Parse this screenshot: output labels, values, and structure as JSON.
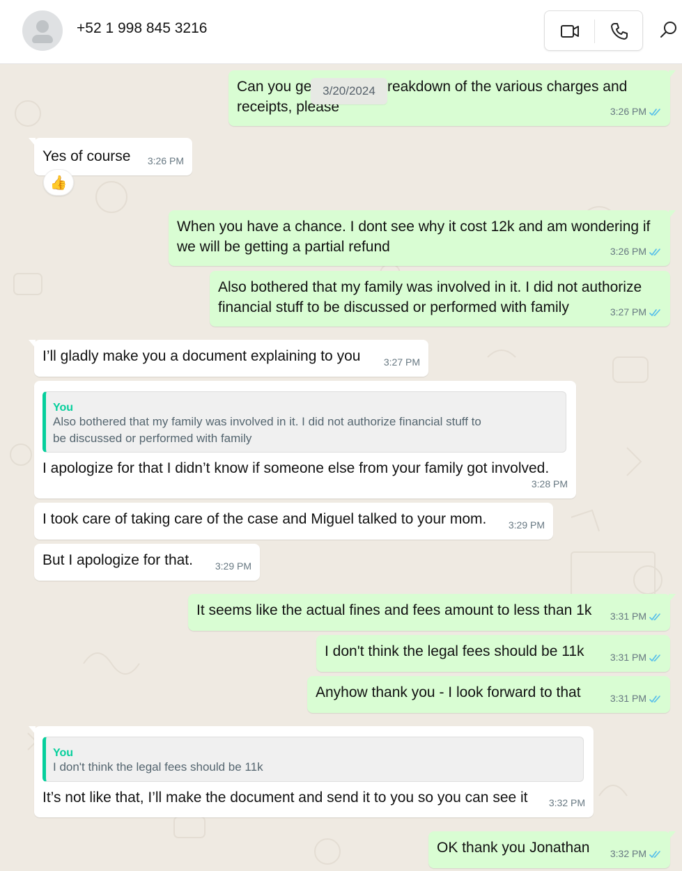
{
  "header": {
    "contact": "+52 1 998 845 3216",
    "video_icon": "video-camera-icon",
    "phone_icon": "phone-icon",
    "search_icon": "search-icon"
  },
  "chat": {
    "date_label": "3/20/2024",
    "messages": [
      {
        "from": "me",
        "line1": "Can you get a written breakdown of the various charges and",
        "line2": "receipts, please",
        "time": "3:26 PM"
      },
      {
        "from": "them",
        "text": "Yes of course",
        "time": "3:26 PM",
        "reaction": "👍"
      },
      {
        "from": "me",
        "line1": "When you have a chance.  I dont see why it cost 12k and am wondering if",
        "line2": "we will be getting a partial refund",
        "time": "3:26 PM"
      },
      {
        "from": "me",
        "line1": "Also bothered that my family was involved in it.  I did not authorize",
        "line2": "financial stuff to be discussed or performed with family",
        "time": "3:27 PM"
      },
      {
        "from": "them",
        "text": "I’ll gladly make you a document explaining to you",
        "time": "3:27 PM"
      },
      {
        "from": "them",
        "quote_name": "You",
        "quote_line1": "Also bothered that my family was involved in it.  I did not authorize financial stuff to",
        "quote_line2": "be discussed or performed with family",
        "text": "I apologize for that I didn’t know if someone else from your family got involved.",
        "time": "3:28 PM"
      },
      {
        "from": "them",
        "text": "I took care of taking care of the case and Miguel talked to your mom.",
        "time": "3:29 PM"
      },
      {
        "from": "them",
        "text": "But I apologize for that.",
        "time": "3:29 PM"
      },
      {
        "from": "me",
        "text": "It seems like the actual fines and fees amount to less than 1k",
        "time": "3:31 PM"
      },
      {
        "from": "me",
        "text": "I don't think the legal fees should be 11k",
        "time": "3:31 PM"
      },
      {
        "from": "me",
        "text": "Anyhow thank you - I look forward to that",
        "time": "3:31 PM"
      },
      {
        "from": "them",
        "quote_name": "You",
        "quote_line1": "I don't think the legal fees should be 11k",
        "text": "It’s not like that, I’ll make the document and send it to you so you can see it",
        "time": "3:32 PM"
      },
      {
        "from": "me",
        "text": "OK thank you Jonathan",
        "time": "3:32 PM"
      }
    ]
  },
  "colors": {
    "outgoing_bubble": "#d9fdd3",
    "incoming_bubble": "#ffffff",
    "wallpaper": "#efeae2",
    "read_ticks": "#53bdeb",
    "quote_accent": "#06cf9c"
  }
}
